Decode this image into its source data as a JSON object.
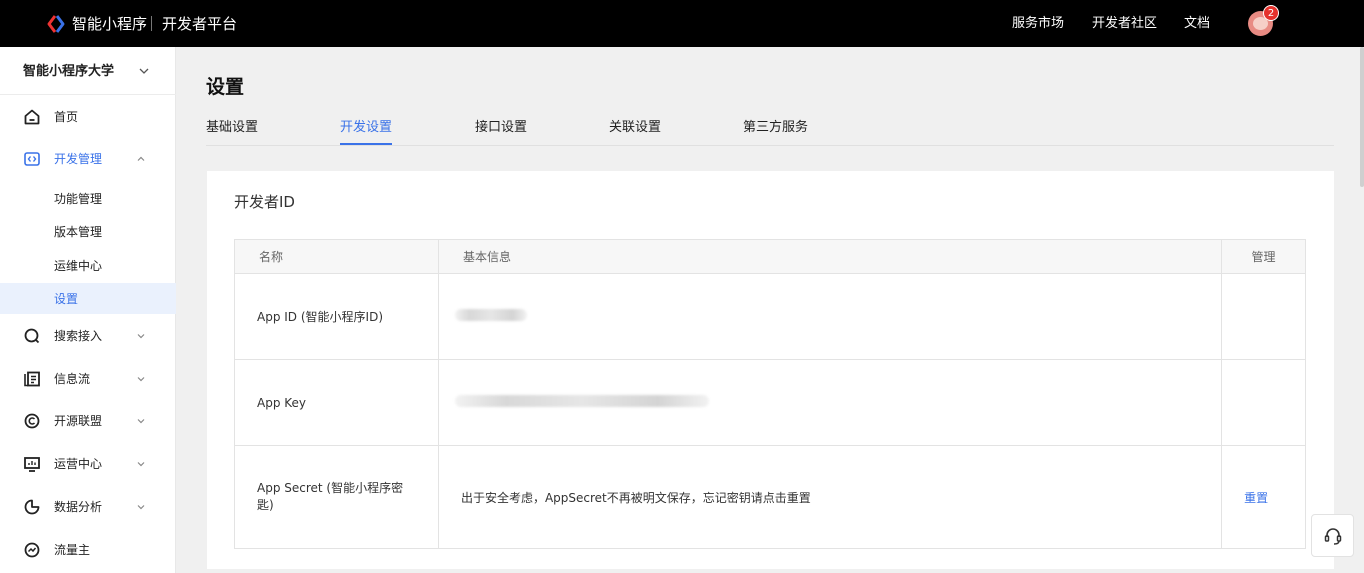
{
  "topbar": {
    "brand": "智能小程序",
    "platform": "开发者平台",
    "nav": [
      "服务市场",
      "开发者社区",
      "文档"
    ],
    "badge_count": "2"
  },
  "sidebar": {
    "app_name": "智能小程序大学",
    "items": {
      "home": "首页",
      "dev": "开发管理",
      "search": "搜索接入",
      "feed": "信息流",
      "opensource": "开源联盟",
      "ops": "运营中心",
      "analytics": "数据分析",
      "traffic": "流量主"
    },
    "dev_sub": [
      "功能管理",
      "版本管理",
      "运维中心",
      "设置"
    ]
  },
  "page": {
    "title": "设置",
    "tabs": [
      "基础设置",
      "开发设置",
      "接口设置",
      "关联设置",
      "第三方服务"
    ],
    "active_tab": "开发设置"
  },
  "developer_id": {
    "title": "开发者ID",
    "headers": [
      "名称",
      "基本信息",
      "管理"
    ],
    "rows": [
      {
        "name": "App ID (智能小程序ID)",
        "value": "",
        "action": ""
      },
      {
        "name": "App Key",
        "value": "",
        "action": ""
      },
      {
        "name": "App Secret (智能小程序密匙)",
        "value": "出于安全考虑，AppSecret不再被明文保存，忘记密钥请点击重置",
        "action": "重置"
      }
    ]
  },
  "colors": {
    "accent": "#3a72e8",
    "topbar_bg": "#000000",
    "badge": "#e5322d"
  }
}
